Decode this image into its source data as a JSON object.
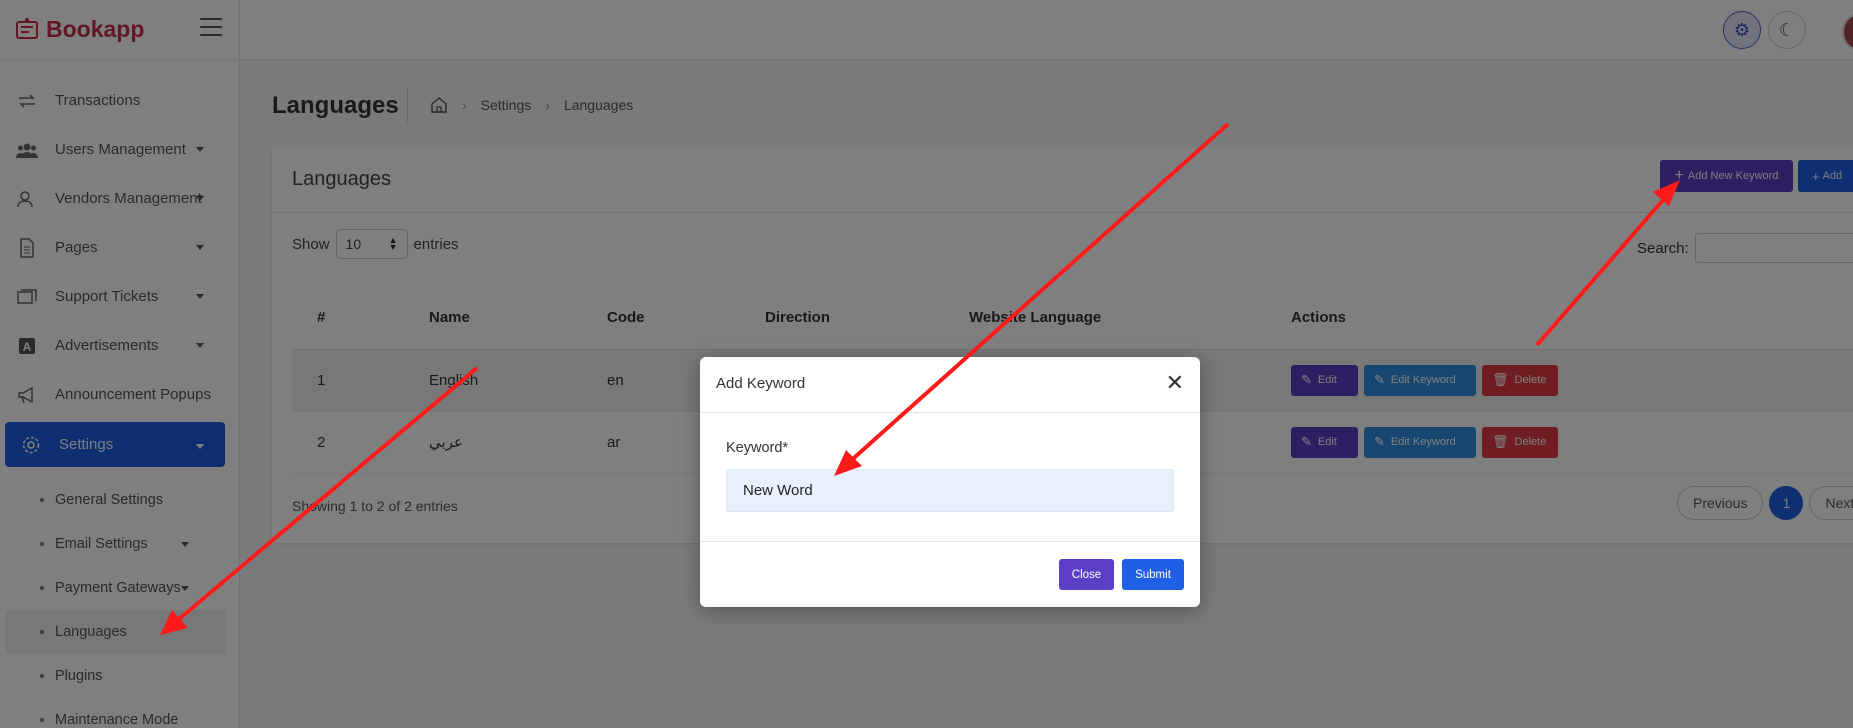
{
  "app": {
    "brand_name": "Bookapp"
  },
  "sidebar": {
    "items": [
      {
        "label": "Transactions",
        "icon": "transactions-icon",
        "caret": false
      },
      {
        "label": "Users Management",
        "icon": "users-icon",
        "caret": true
      },
      {
        "label": "Vendors Management",
        "icon": "vendors-icon",
        "caret": true
      },
      {
        "label": "Pages",
        "icon": "pages-icon",
        "caret": true
      },
      {
        "label": "Support Tickets",
        "icon": "tickets-icon",
        "caret": true
      },
      {
        "label": "Advertisements",
        "icon": "advertisements-icon",
        "caret": true
      },
      {
        "label": "Announcement Popups",
        "icon": "megaphone-icon",
        "caret": false
      },
      {
        "label": "Settings",
        "icon": "gear-icon",
        "caret": true,
        "active": true
      }
    ],
    "sub_items": [
      {
        "label": "General Settings"
      },
      {
        "label": "Email Settings",
        "caret": true
      },
      {
        "label": "Payment Gateways",
        "caret": true
      },
      {
        "label": "Languages",
        "current": true
      },
      {
        "label": "Plugins"
      },
      {
        "label": "Maintenance Mode"
      }
    ]
  },
  "page": {
    "title": "Languages",
    "breadcrumb": [
      "Settings",
      "Languages"
    ]
  },
  "card": {
    "title": "Languages",
    "add_keyword_label": "Add New Keyword",
    "add_label": "Add",
    "show_label": "Show",
    "entries_label": "entries",
    "page_size": "10",
    "search_label": "Search:",
    "columns": [
      "#",
      "Name",
      "Code",
      "Direction",
      "Website Language",
      "Actions"
    ],
    "rows": [
      {
        "num": "1",
        "name": "English",
        "code": "en"
      },
      {
        "num": "2",
        "name": "عربي",
        "code": "ar"
      }
    ],
    "actions": {
      "edit": "Edit",
      "edit_keyword": "Edit Keyword",
      "delete": "Delete"
    },
    "showing": "Showing 1 to 2 of 2 entries",
    "pagination": {
      "previous": "Previous",
      "current": "1",
      "next": "Next"
    }
  },
  "modal": {
    "title": "Add Keyword",
    "keyword_label": "Keyword*",
    "keyword_value": "New Word",
    "close_label": "Close",
    "submit_label": "Submit"
  },
  "colors": {
    "brand": "#c5304a",
    "primary": "#1f5fe6",
    "purple": "#5c3ec7",
    "info": "#2e8fe0",
    "danger": "#e03a44",
    "annotation": "#ff1a1a"
  }
}
